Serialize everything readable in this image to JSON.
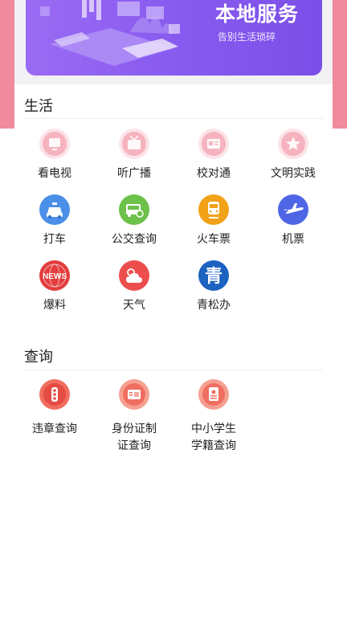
{
  "banner": {
    "title": "本地服务",
    "subtitle": "告别生活琐碎"
  },
  "sections": [
    {
      "title": "生活",
      "items": [
        {
          "label": "看电视",
          "icon": "tv-icon"
        },
        {
          "label": "听广播",
          "icon": "radio-icon"
        },
        {
          "label": "校对通",
          "icon": "id-card-icon"
        },
        {
          "label": "文明实践",
          "icon": "star-icon"
        },
        {
          "label": "打车",
          "icon": "taxi-icon"
        },
        {
          "label": "公交查询",
          "icon": "bus-icon"
        },
        {
          "label": "火车票",
          "icon": "train-icon"
        },
        {
          "label": "机票",
          "icon": "plane-icon"
        },
        {
          "label": "爆料",
          "icon": "news-icon",
          "badge": "NEWS"
        },
        {
          "label": "天气",
          "icon": "weather-icon"
        },
        {
          "label": "青松办",
          "icon": "qingsong-icon",
          "badge": "青"
        }
      ]
    },
    {
      "title": "查询",
      "items": [
        {
          "label": "违章查询",
          "icon": "traffic-light-icon"
        },
        {
          "label_line1": "身份证制",
          "label_line2": "证查询",
          "icon": "id-document-icon"
        },
        {
          "label_line1": "中小学生",
          "label_line2": "学籍查询",
          "icon": "student-record-icon"
        }
      ]
    }
  ],
  "colors": {
    "banner": "#8a5cf0",
    "pink_icon": "#f6b3bf",
    "taxi": "#4a90e8",
    "bus": "#6cc14a",
    "train": "#f2a216",
    "plane": "#4e66e6",
    "news": "#e43d3d",
    "weather": "#ec4d4d",
    "qingsong": "#1c62c0",
    "query": "#f06d5f"
  }
}
